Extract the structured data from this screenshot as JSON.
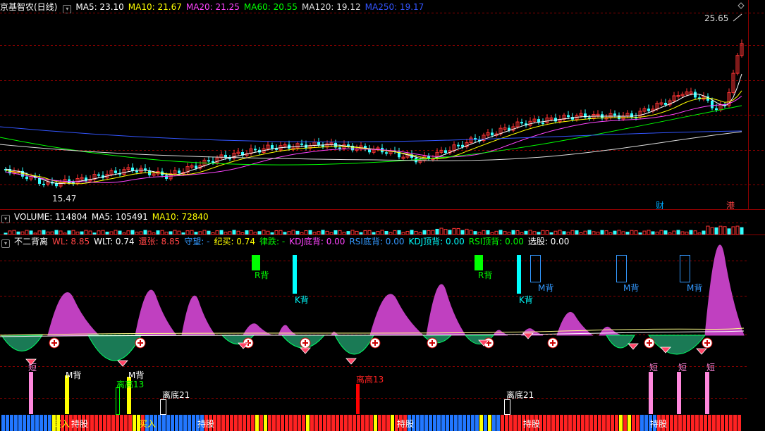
{
  "main_pane": {
    "title": "京基智农(日线)",
    "ma": [
      {
        "label": "MA5: 23.10",
        "color": "#ffffff"
      },
      {
        "label": "MA10: 21.67",
        "color": "#ffff00"
      },
      {
        "label": "MA20: 21.25",
        "color": "#ff44ff"
      },
      {
        "label": "MA60: 20.55",
        "color": "#00ff00"
      },
      {
        "label": "MA120: 19.12",
        "color": "#dddddd"
      },
      {
        "label": "MA250: 19.17",
        "color": "#3355ff"
      }
    ],
    "high_label": "25.65",
    "low_label": "15.47",
    "marker_cai": "财",
    "marker_gang": "港"
  },
  "volume_pane": {
    "labels": [
      {
        "label": "VOLUME: 114804",
        "color": "#ffffff"
      },
      {
        "label": "MA5: 105491",
        "color": "#ffffff"
      },
      {
        "label": "MA10: 72840",
        "color": "#ffff00"
      }
    ]
  },
  "indicator_pane": {
    "title": "不二背离",
    "items": [
      {
        "label": "WL: 8.85",
        "color": "#ff4444"
      },
      {
        "label": "WLT: 0.74",
        "color": "#ffffff"
      },
      {
        "label": "還张: 8.85",
        "color": "#ff4444"
      },
      {
        "label": "守望: -",
        "color": "#3399ff"
      },
      {
        "label": "纪买: 0.74",
        "color": "#ffff00"
      },
      {
        "label": "律跌: -",
        "color": "#00ff00"
      },
      {
        "label": "KDJ底背: 0.00",
        "color": "#ff44ff"
      },
      {
        "label": "RSI底背: 0.00",
        "color": "#3399ff"
      },
      {
        "label": "KDJ顶背: 0.00",
        "color": "#00ffff"
      },
      {
        "label": "RSI顶背: 0.00",
        "color": "#00ff00"
      },
      {
        "label": "选股: 0.00",
        "color": "#ffffff"
      }
    ],
    "signals": {
      "r_bei": "R背",
      "k_bei": "K背",
      "m_bei": "M背",
      "duan": "短",
      "li_gao": "离高13",
      "li_di": "离底21",
      "mai_ru": "买入",
      "chi_gu": "持股"
    }
  },
  "colors": {
    "up": "#ff3333",
    "down": "#33ffff",
    "grid": "#8b0000"
  }
}
